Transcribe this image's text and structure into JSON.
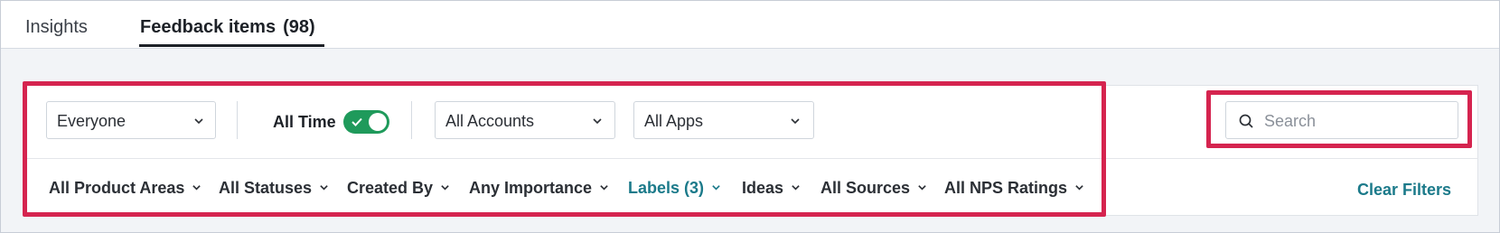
{
  "tabs": [
    {
      "label": "Insights"
    },
    {
      "label": "Feedback items",
      "count": "(98)"
    }
  ],
  "toolbar": {
    "people_select": "Everyone",
    "time_label": "All Time",
    "time_toggle_on": true,
    "accounts_select": "All Accounts",
    "apps_select": "All Apps"
  },
  "search": {
    "placeholder": "Search",
    "value": ""
  },
  "filters": [
    {
      "label": "All Product Areas"
    },
    {
      "label": "All Statuses"
    },
    {
      "label": "Created By"
    },
    {
      "label": "Any Importance"
    },
    {
      "label": "Labels (3)",
      "active": true
    },
    {
      "label": "Ideas"
    },
    {
      "label": "All Sources"
    },
    {
      "label": "All NPS Ratings"
    }
  ],
  "clear_filters": "Clear Filters",
  "colors": {
    "accent": "#1b7a8a",
    "toggle_on": "#1f9a5b",
    "highlight": "#d5244f"
  }
}
